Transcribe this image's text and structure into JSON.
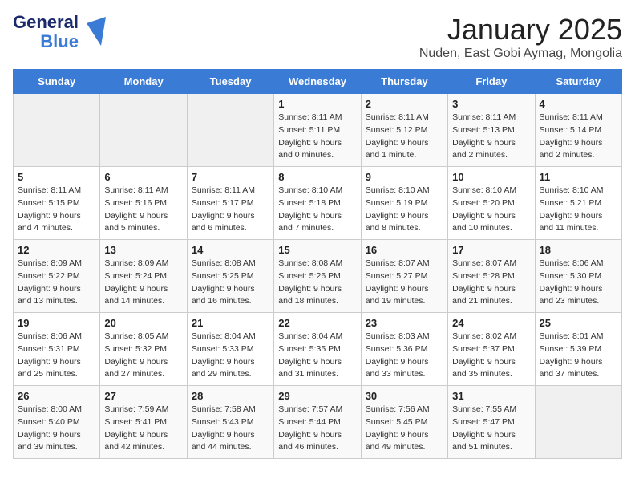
{
  "logo": {
    "general": "General",
    "blue": "Blue",
    "bird_icon": "▶"
  },
  "calendar": {
    "title": "January 2025",
    "subtitle": "Nuden, East Gobi Aymag, Mongolia"
  },
  "weekdays": [
    "Sunday",
    "Monday",
    "Tuesday",
    "Wednesday",
    "Thursday",
    "Friday",
    "Saturday"
  ],
  "weeks": [
    [
      {
        "day": "",
        "info": ""
      },
      {
        "day": "",
        "info": ""
      },
      {
        "day": "",
        "info": ""
      },
      {
        "day": "1",
        "info": "Sunrise: 8:11 AM\nSunset: 5:11 PM\nDaylight: 9 hours\nand 0 minutes."
      },
      {
        "day": "2",
        "info": "Sunrise: 8:11 AM\nSunset: 5:12 PM\nDaylight: 9 hours\nand 1 minute."
      },
      {
        "day": "3",
        "info": "Sunrise: 8:11 AM\nSunset: 5:13 PM\nDaylight: 9 hours\nand 2 minutes."
      },
      {
        "day": "4",
        "info": "Sunrise: 8:11 AM\nSunset: 5:14 PM\nDaylight: 9 hours\nand 2 minutes."
      }
    ],
    [
      {
        "day": "5",
        "info": "Sunrise: 8:11 AM\nSunset: 5:15 PM\nDaylight: 9 hours\nand 4 minutes."
      },
      {
        "day": "6",
        "info": "Sunrise: 8:11 AM\nSunset: 5:16 PM\nDaylight: 9 hours\nand 5 minutes."
      },
      {
        "day": "7",
        "info": "Sunrise: 8:11 AM\nSunset: 5:17 PM\nDaylight: 9 hours\nand 6 minutes."
      },
      {
        "day": "8",
        "info": "Sunrise: 8:10 AM\nSunset: 5:18 PM\nDaylight: 9 hours\nand 7 minutes."
      },
      {
        "day": "9",
        "info": "Sunrise: 8:10 AM\nSunset: 5:19 PM\nDaylight: 9 hours\nand 8 minutes."
      },
      {
        "day": "10",
        "info": "Sunrise: 8:10 AM\nSunset: 5:20 PM\nDaylight: 9 hours\nand 10 minutes."
      },
      {
        "day": "11",
        "info": "Sunrise: 8:10 AM\nSunset: 5:21 PM\nDaylight: 9 hours\nand 11 minutes."
      }
    ],
    [
      {
        "day": "12",
        "info": "Sunrise: 8:09 AM\nSunset: 5:22 PM\nDaylight: 9 hours\nand 13 minutes."
      },
      {
        "day": "13",
        "info": "Sunrise: 8:09 AM\nSunset: 5:24 PM\nDaylight: 9 hours\nand 14 minutes."
      },
      {
        "day": "14",
        "info": "Sunrise: 8:08 AM\nSunset: 5:25 PM\nDaylight: 9 hours\nand 16 minutes."
      },
      {
        "day": "15",
        "info": "Sunrise: 8:08 AM\nSunset: 5:26 PM\nDaylight: 9 hours\nand 18 minutes."
      },
      {
        "day": "16",
        "info": "Sunrise: 8:07 AM\nSunset: 5:27 PM\nDaylight: 9 hours\nand 19 minutes."
      },
      {
        "day": "17",
        "info": "Sunrise: 8:07 AM\nSunset: 5:28 PM\nDaylight: 9 hours\nand 21 minutes."
      },
      {
        "day": "18",
        "info": "Sunrise: 8:06 AM\nSunset: 5:30 PM\nDaylight: 9 hours\nand 23 minutes."
      }
    ],
    [
      {
        "day": "19",
        "info": "Sunrise: 8:06 AM\nSunset: 5:31 PM\nDaylight: 9 hours\nand 25 minutes."
      },
      {
        "day": "20",
        "info": "Sunrise: 8:05 AM\nSunset: 5:32 PM\nDaylight: 9 hours\nand 27 minutes."
      },
      {
        "day": "21",
        "info": "Sunrise: 8:04 AM\nSunset: 5:33 PM\nDaylight: 9 hours\nand 29 minutes."
      },
      {
        "day": "22",
        "info": "Sunrise: 8:04 AM\nSunset: 5:35 PM\nDaylight: 9 hours\nand 31 minutes."
      },
      {
        "day": "23",
        "info": "Sunrise: 8:03 AM\nSunset: 5:36 PM\nDaylight: 9 hours\nand 33 minutes."
      },
      {
        "day": "24",
        "info": "Sunrise: 8:02 AM\nSunset: 5:37 PM\nDaylight: 9 hours\nand 35 minutes."
      },
      {
        "day": "25",
        "info": "Sunrise: 8:01 AM\nSunset: 5:39 PM\nDaylight: 9 hours\nand 37 minutes."
      }
    ],
    [
      {
        "day": "26",
        "info": "Sunrise: 8:00 AM\nSunset: 5:40 PM\nDaylight: 9 hours\nand 39 minutes."
      },
      {
        "day": "27",
        "info": "Sunrise: 7:59 AM\nSunset: 5:41 PM\nDaylight: 9 hours\nand 42 minutes."
      },
      {
        "day": "28",
        "info": "Sunrise: 7:58 AM\nSunset: 5:43 PM\nDaylight: 9 hours\nand 44 minutes."
      },
      {
        "day": "29",
        "info": "Sunrise: 7:57 AM\nSunset: 5:44 PM\nDaylight: 9 hours\nand 46 minutes."
      },
      {
        "day": "30",
        "info": "Sunrise: 7:56 AM\nSunset: 5:45 PM\nDaylight: 9 hours\nand 49 minutes."
      },
      {
        "day": "31",
        "info": "Sunrise: 7:55 AM\nSunset: 5:47 PM\nDaylight: 9 hours\nand 51 minutes."
      },
      {
        "day": "",
        "info": ""
      }
    ]
  ]
}
